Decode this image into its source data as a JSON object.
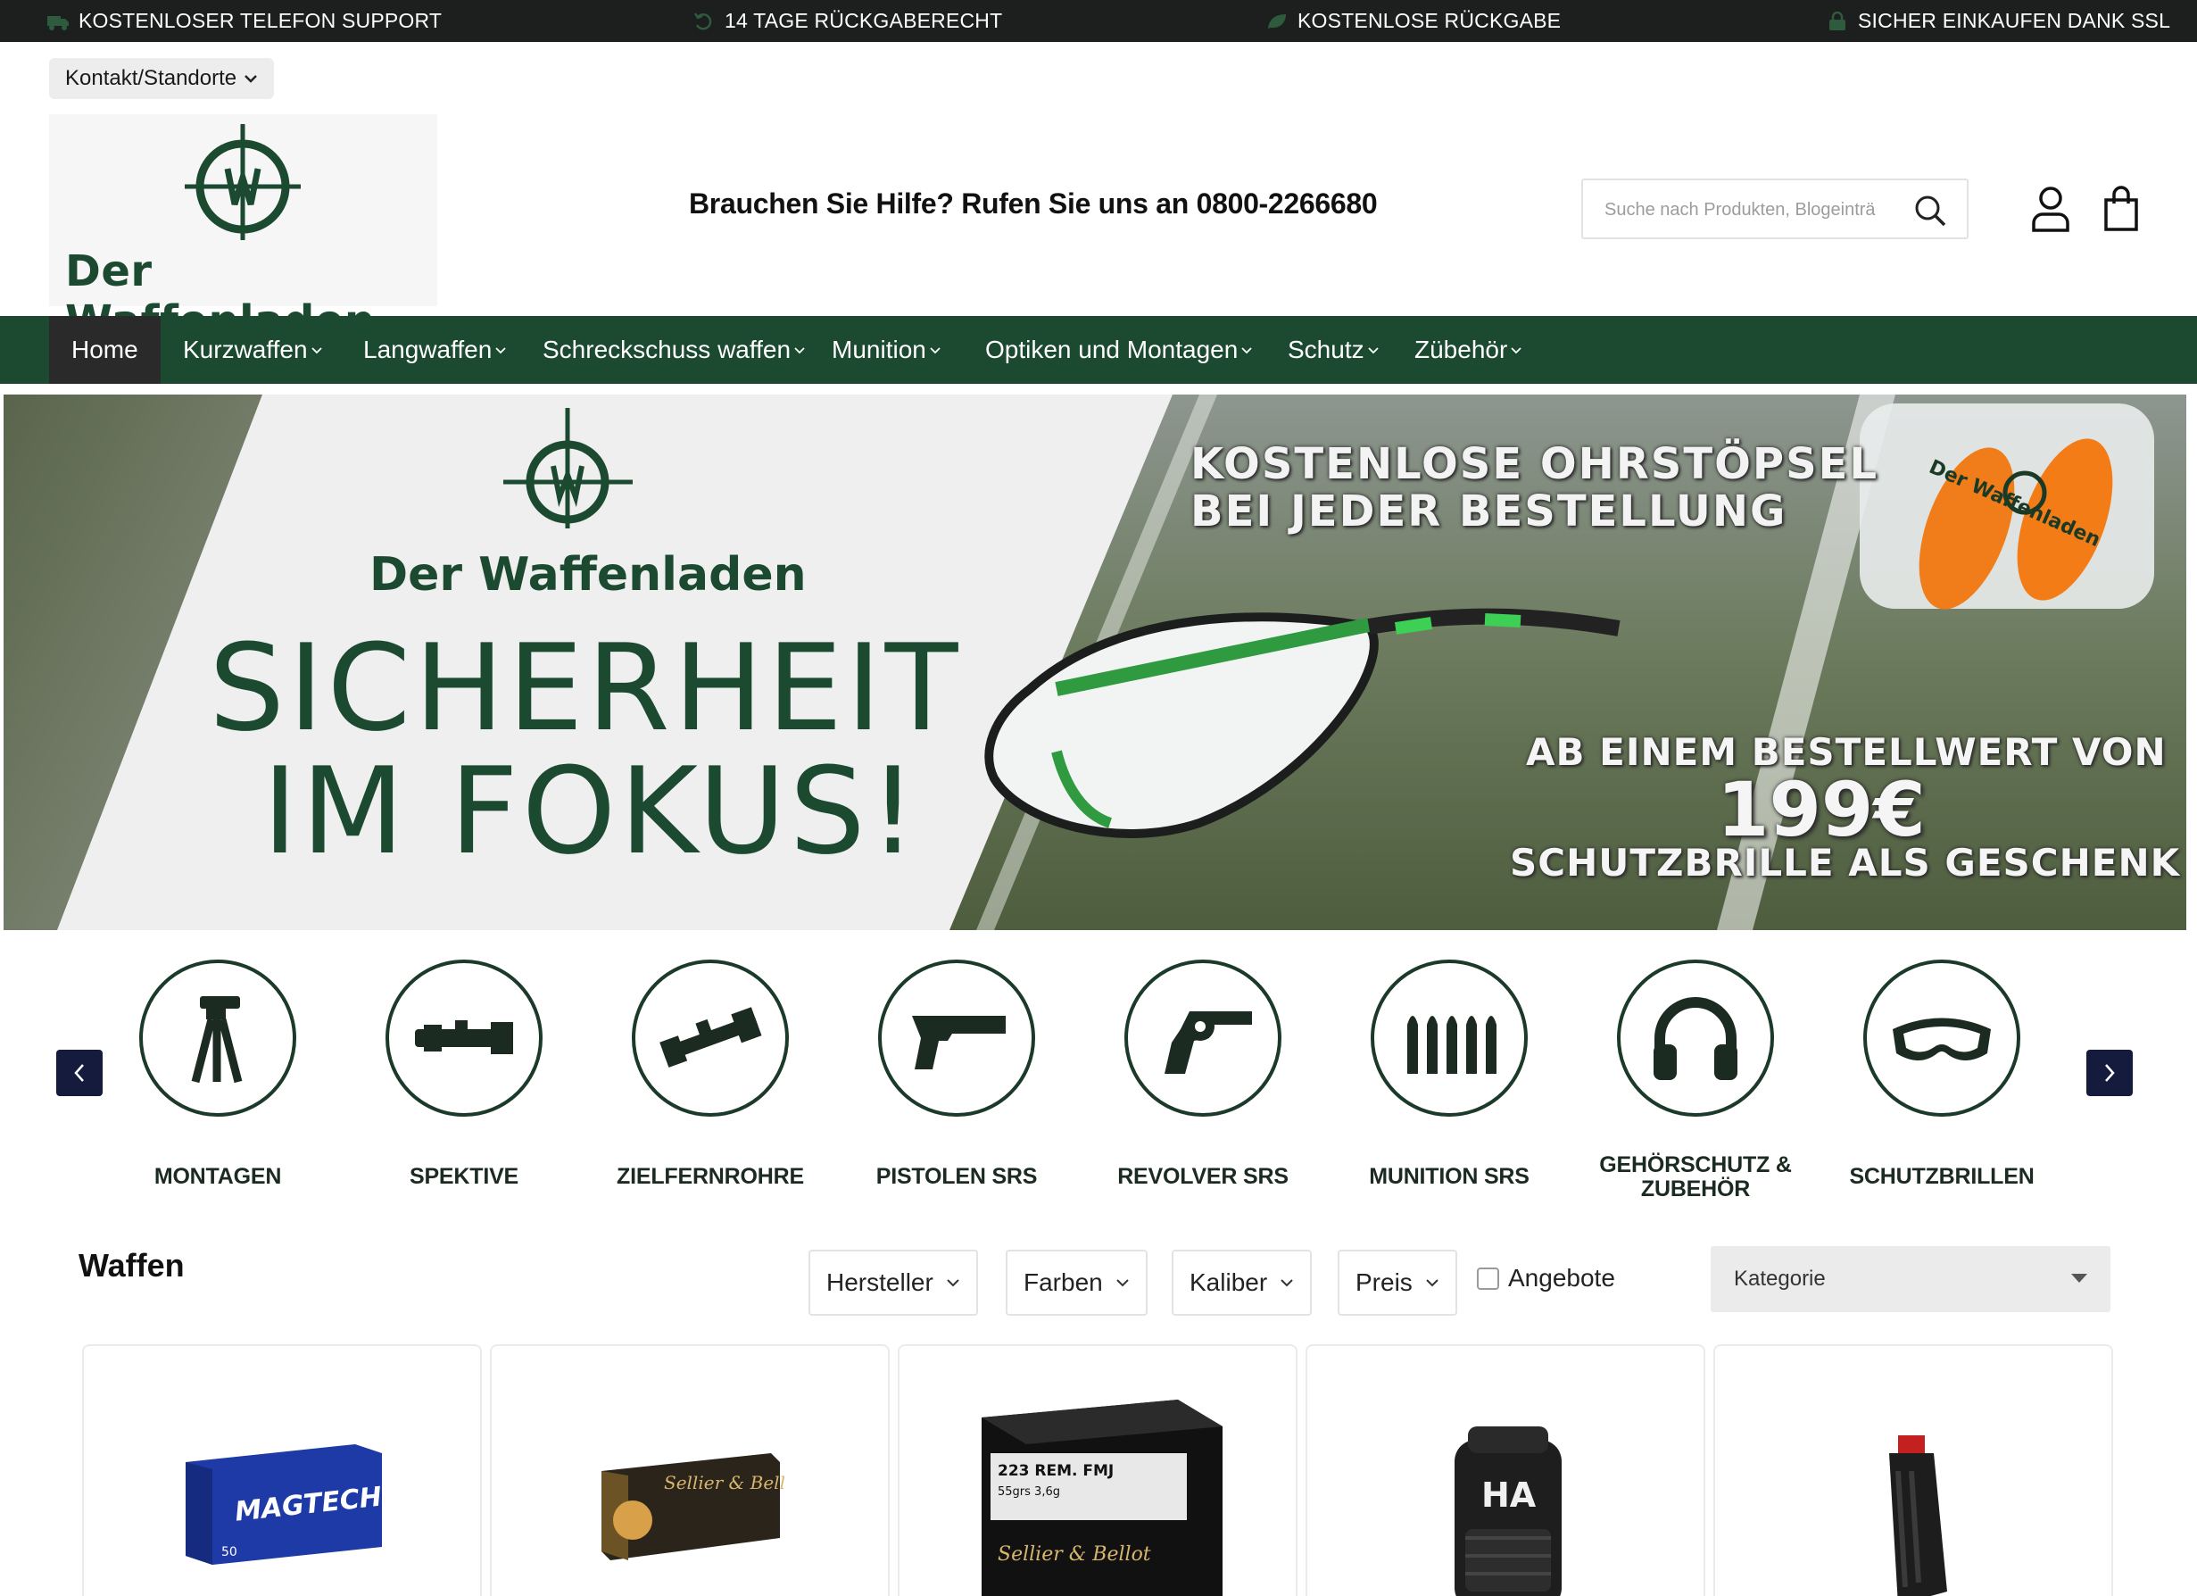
{
  "topbar": {
    "items": [
      {
        "icon": "truck-icon",
        "label": "KOSTENLOSER TELEFON SUPPORT"
      },
      {
        "icon": "return-icon",
        "label": "14 TAGE RÜCKGABERECHT"
      },
      {
        "icon": "leaf-icon",
        "label": "KOSTENLOSE RÜCKGABE"
      },
      {
        "icon": "lock-icon",
        "label": "SICHER EINKAUFEN DANK SSL"
      }
    ]
  },
  "header": {
    "contact_label": "Kontakt/Standorte",
    "logo_text": "Der Waffenladen",
    "helpline": "Brauchen Sie Hilfe? Rufen Sie uns an 0800-2266680",
    "search_placeholder": "Suche nach Produkten, Blogeinträ"
  },
  "nav": {
    "items": [
      {
        "label": "Home",
        "active": true
      },
      {
        "label": "Kurzwaffen"
      },
      {
        "label": "Langwaffen"
      },
      {
        "label": "Schreckschuss waffen"
      },
      {
        "label": "Munition"
      },
      {
        "label": "Optiken und Montagen"
      },
      {
        "label": "Schutz"
      },
      {
        "label": "Zübehör"
      }
    ]
  },
  "banner": {
    "brand": "Der Waffenladen",
    "headline_1": "SICHERHEIT",
    "headline_2": "IM FOKUS!",
    "promo_1": "KOSTENLOSE OHRSTÖPSEL",
    "promo_2": "BEI JEDER BESTELLUNG",
    "promo_3": "AB EINEM BESTELLWERT VON",
    "price": "199€",
    "promo_4": "SCHUTZBRILLE ALS GESCHENK",
    "box_label": "Der Waffenladen"
  },
  "categories": [
    {
      "label": "MONTAGEN",
      "icon": "tripod-icon"
    },
    {
      "label": "SPEKTIVE",
      "icon": "spotting-scope-icon"
    },
    {
      "label": "ZIELFERNROHRE",
      "icon": "rifle-scope-icon"
    },
    {
      "label": "PISTOLEN SRS",
      "icon": "pistol-icon"
    },
    {
      "label": "REVOLVER SRS",
      "icon": "revolver-icon"
    },
    {
      "label": "MUNITION SRS",
      "icon": "ammunition-icon"
    },
    {
      "label": "GEHÖRSCHUTZ & ZUBEHÖR",
      "icon": "headphones-icon"
    },
    {
      "label": "SCHUTZBRILLEN",
      "icon": "goggles-icon"
    }
  ],
  "section": {
    "title": "Waffen",
    "filters": [
      "Hersteller",
      "Farben",
      "Kaliber",
      "Preis"
    ],
    "offers_label": "Angebote",
    "offers_checked": false,
    "category_select": "Kategorie"
  },
  "products": [
    {
      "image": "magtech-ammo-box",
      "box_text": "MAGTECH",
      "box_subtext": "50"
    },
    {
      "image": "sellier-bellot-ammo-box",
      "box_text": "Sellier & Bellot"
    },
    {
      "image": "sellier-bellot-223-box",
      "box_text": "223 REM. FMJ",
      "box_subtext": "55grs 3,6g",
      "brand_text": "Sellier & Bellot"
    },
    {
      "image": "tactical-backpack",
      "box_text": "HA"
    },
    {
      "image": "rifle-magazine"
    }
  ],
  "colors": {
    "brand_green": "#1b4a30",
    "topbar_bg": "#1c1f1d",
    "carousel_button": "#141b3d",
    "icon_stroke": "#1b3a2a"
  }
}
